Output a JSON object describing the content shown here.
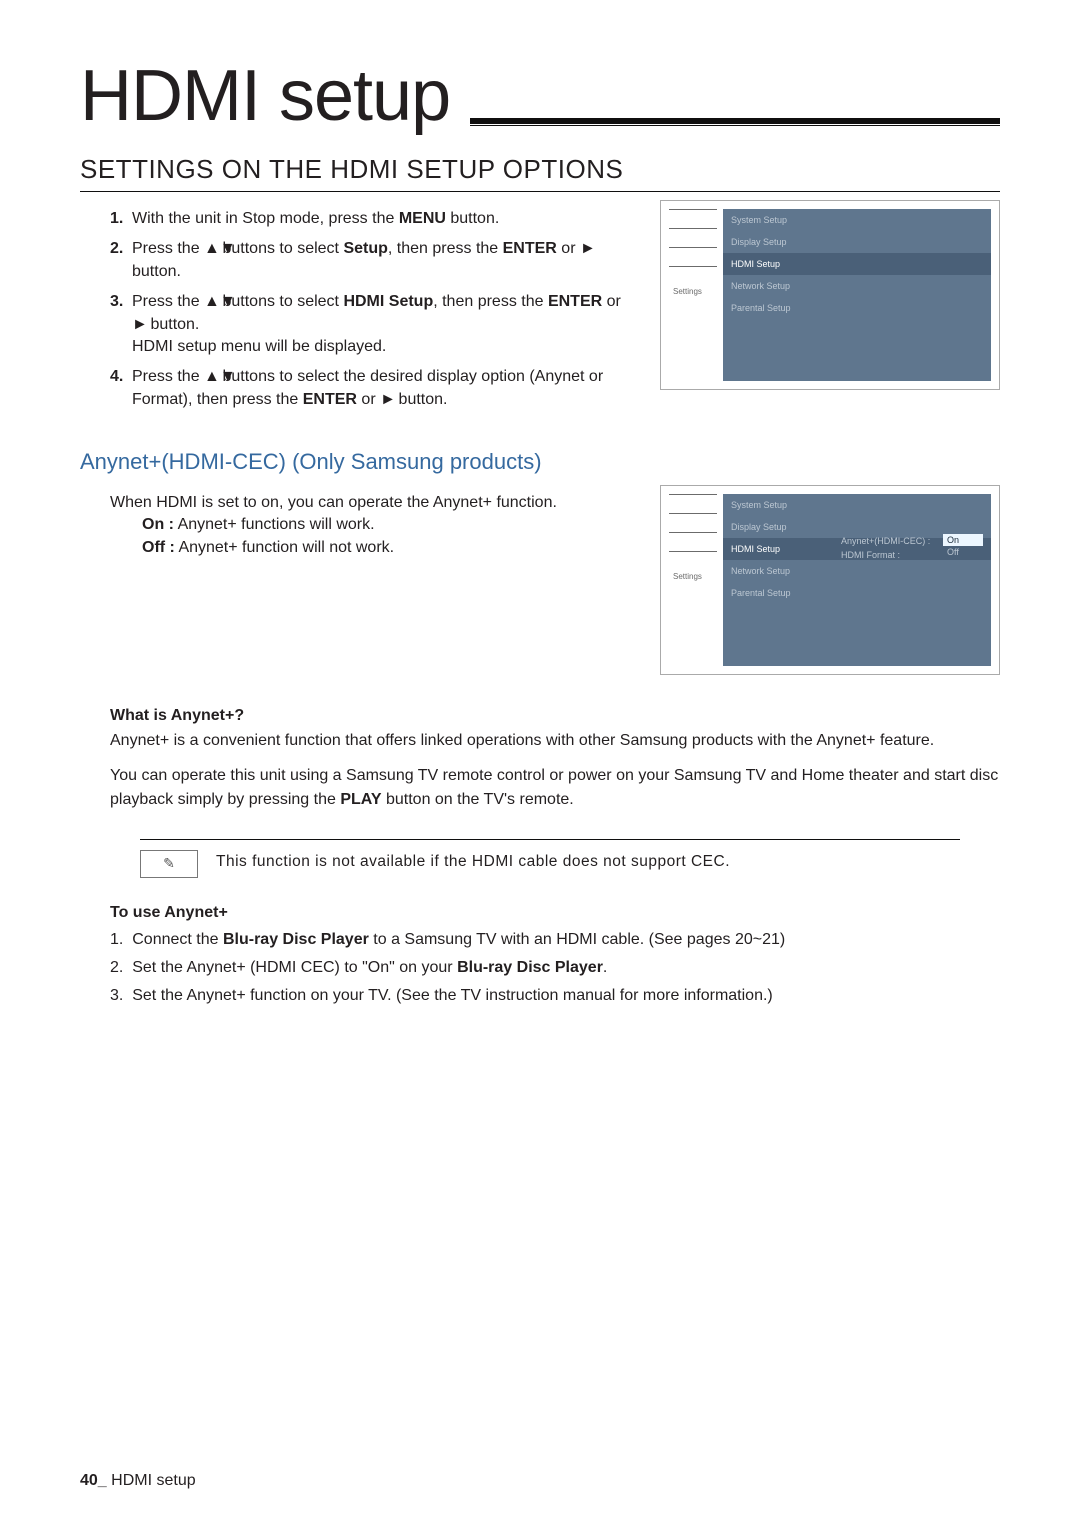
{
  "title": "HDMI setup",
  "section1": {
    "heading": "SETTINGS ON THE HDMI SETUP OPTIONS",
    "steps": [
      {
        "num": "1.",
        "pre": "With the unit in Stop mode, press the ",
        "bold1": "MENU",
        "post1": " button."
      },
      {
        "num": "2.",
        "pre": "Press the ",
        "icon": "▲▼",
        "mid": " buttons to select ",
        "bold1": "Setup",
        "post1": ", then press the ",
        "bold2": "ENTER",
        "post2": " or ",
        "icon2": "►",
        "post3": " button."
      },
      {
        "num": "3.",
        "pre": "Press the ",
        "icon": "▲▼",
        "mid": " buttons to select ",
        "bold1": "HDMI Setup",
        "post1": ", then press the ",
        "bold2": "ENTER",
        "post2": " or ",
        "icon2": "►",
        "post3": " button.",
        "extra": "HDMI setup menu will be displayed."
      },
      {
        "num": "4.",
        "pre": "Press the ",
        "icon": "▲▼",
        "mid": " buttons to select the desired display option (Anynet or Format), then press the ",
        "bold1": "ENTER",
        "post1": " or ",
        "icon2": "►",
        "post3": " button."
      }
    ],
    "panelMenu": [
      "System Setup",
      "Display Setup",
      "HDMI Setup",
      "Network Setup",
      "Parental Setup"
    ],
    "panelSelectedIndex": 2,
    "panelGhost": "Settings"
  },
  "section2": {
    "heading": "Anynet+(HDMI-CEC) (Only Samsung products)",
    "intro": "When HDMI is set to on, you can operate the Anynet+ function.",
    "on": {
      "label": "On :",
      "text": " Anynet+ functions will work."
    },
    "off": {
      "label": "Off :",
      "text": " Anynet+ function will not work."
    },
    "panelMenu": [
      "System Setup",
      "Display Setup",
      "HDMI Setup",
      "Network Setup",
      "Parental Setup"
    ],
    "subItemLabel": "Anynet+(HDMI-CEC) :",
    "subItemLabel2": "HDMI Format  :",
    "subOptions": [
      "On",
      "Off"
    ],
    "panelGhost": "Settings"
  },
  "what": {
    "heading": "What is Anynet+?",
    "p1": "Anynet+ is a convenient function that offers linked operations with other Samsung products with the Anynet+ feature.",
    "p2_pre": "You can operate this unit using a Samsung TV remote control or power on your Samsung TV and Home theater and start disc playback simply by pressing the ",
    "p2_bold": "PLAY",
    "p2_post": " button on the TV's remote."
  },
  "note": "This function is not available if the HDMI cable does not support CEC.",
  "toUse": {
    "heading": "To use Anynet+",
    "items": [
      {
        "n": "1.",
        "pre": "Connect the ",
        "bold": "Blu-ray Disc Player",
        "post": " to a Samsung TV with an HDMI cable. (See pages 20~21)"
      },
      {
        "n": "2.",
        "pre": "Set the Anynet+ (HDMI CEC) to \"On\" on your ",
        "bold": "Blu-ray Disc Player",
        "post": "."
      },
      {
        "n": "3.",
        "pre": "Set the Anynet+ function on your TV. (See the TV instruction manual for more information.)",
        "bold": "",
        "post": ""
      }
    ]
  },
  "footer": {
    "page": "40_",
    "label": " HDMI setup"
  }
}
